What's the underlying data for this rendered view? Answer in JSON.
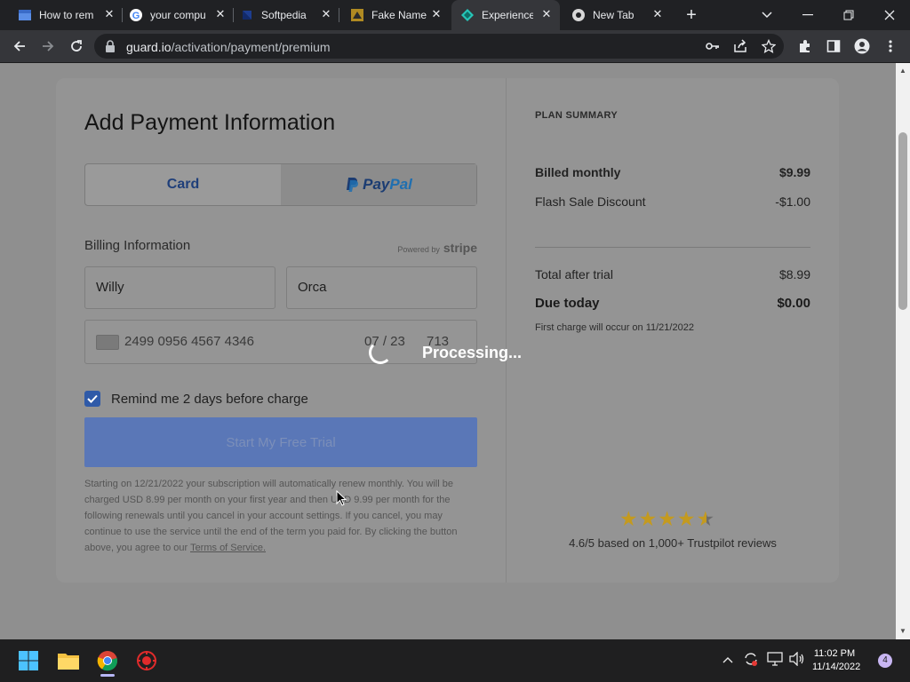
{
  "browser": {
    "tabs": [
      {
        "label": "How to rem",
        "favicon": "blue-square-icon"
      },
      {
        "label": "your compu",
        "favicon": "google-icon"
      },
      {
        "label": "Softpedia",
        "favicon": "softpedia-icon"
      },
      {
        "label": "Fake Name",
        "favicon": "fake-name-icon"
      },
      {
        "label": "Experience",
        "favicon": "guard-icon",
        "active": true
      },
      {
        "label": "New Tab",
        "favicon": "chrome-icon"
      }
    ],
    "url_host": "guard.io",
    "url_path": "/activation/payment/premium"
  },
  "payment": {
    "title": "Add Payment Information",
    "tab_card": "Card",
    "tab_paypal_a": "Pay",
    "tab_paypal_b": "Pal",
    "billing_label": "Billing Information",
    "powered_by": "Powered by",
    "stripe": "stripe",
    "first_name": "Willy",
    "last_name": "Orca",
    "card_number": "2499 0956 4567 4346",
    "card_expiry": "07 / 23",
    "card_cvc": "713",
    "remind_label": "Remind me 2 days before charge",
    "remind_checked": true,
    "cta_label": "Start My Free Trial",
    "legal_text": "Starting on 12/21/2022 your subscription will automatically renew monthly. You will be charged USD 8.99 per month on your first year and then USD 9.99 per month for the following renewals until you cancel in your account settings. If you cancel, you may continue to use the service until the end of the term you paid for. By clicking the button above, you agree to our",
    "terms_link": "Terms of Service.",
    "processing": "Processing..."
  },
  "summary": {
    "heading": "PLAN SUMMARY",
    "billed_label": "Billed monthly",
    "billed_value": "$9.99",
    "discount_label": "Flash Sale Discount",
    "discount_value": "-$1.00",
    "total_label": "Total after trial",
    "total_value": "$8.99",
    "due_label": "Due today",
    "due_value": "$0.00",
    "first_charge": "First charge will occur on 11/21/2022",
    "rating_stars": 4.5,
    "rating_text": "4.6/5 based on 1,000+ Trustpilot reviews"
  },
  "taskbar": {
    "time": "11:02 PM",
    "date": "11/14/2022",
    "notifications": "4"
  },
  "colors": {
    "accent": "#5a77b7",
    "checkbox": "#2f5aa8",
    "star": "#c49a1f"
  }
}
